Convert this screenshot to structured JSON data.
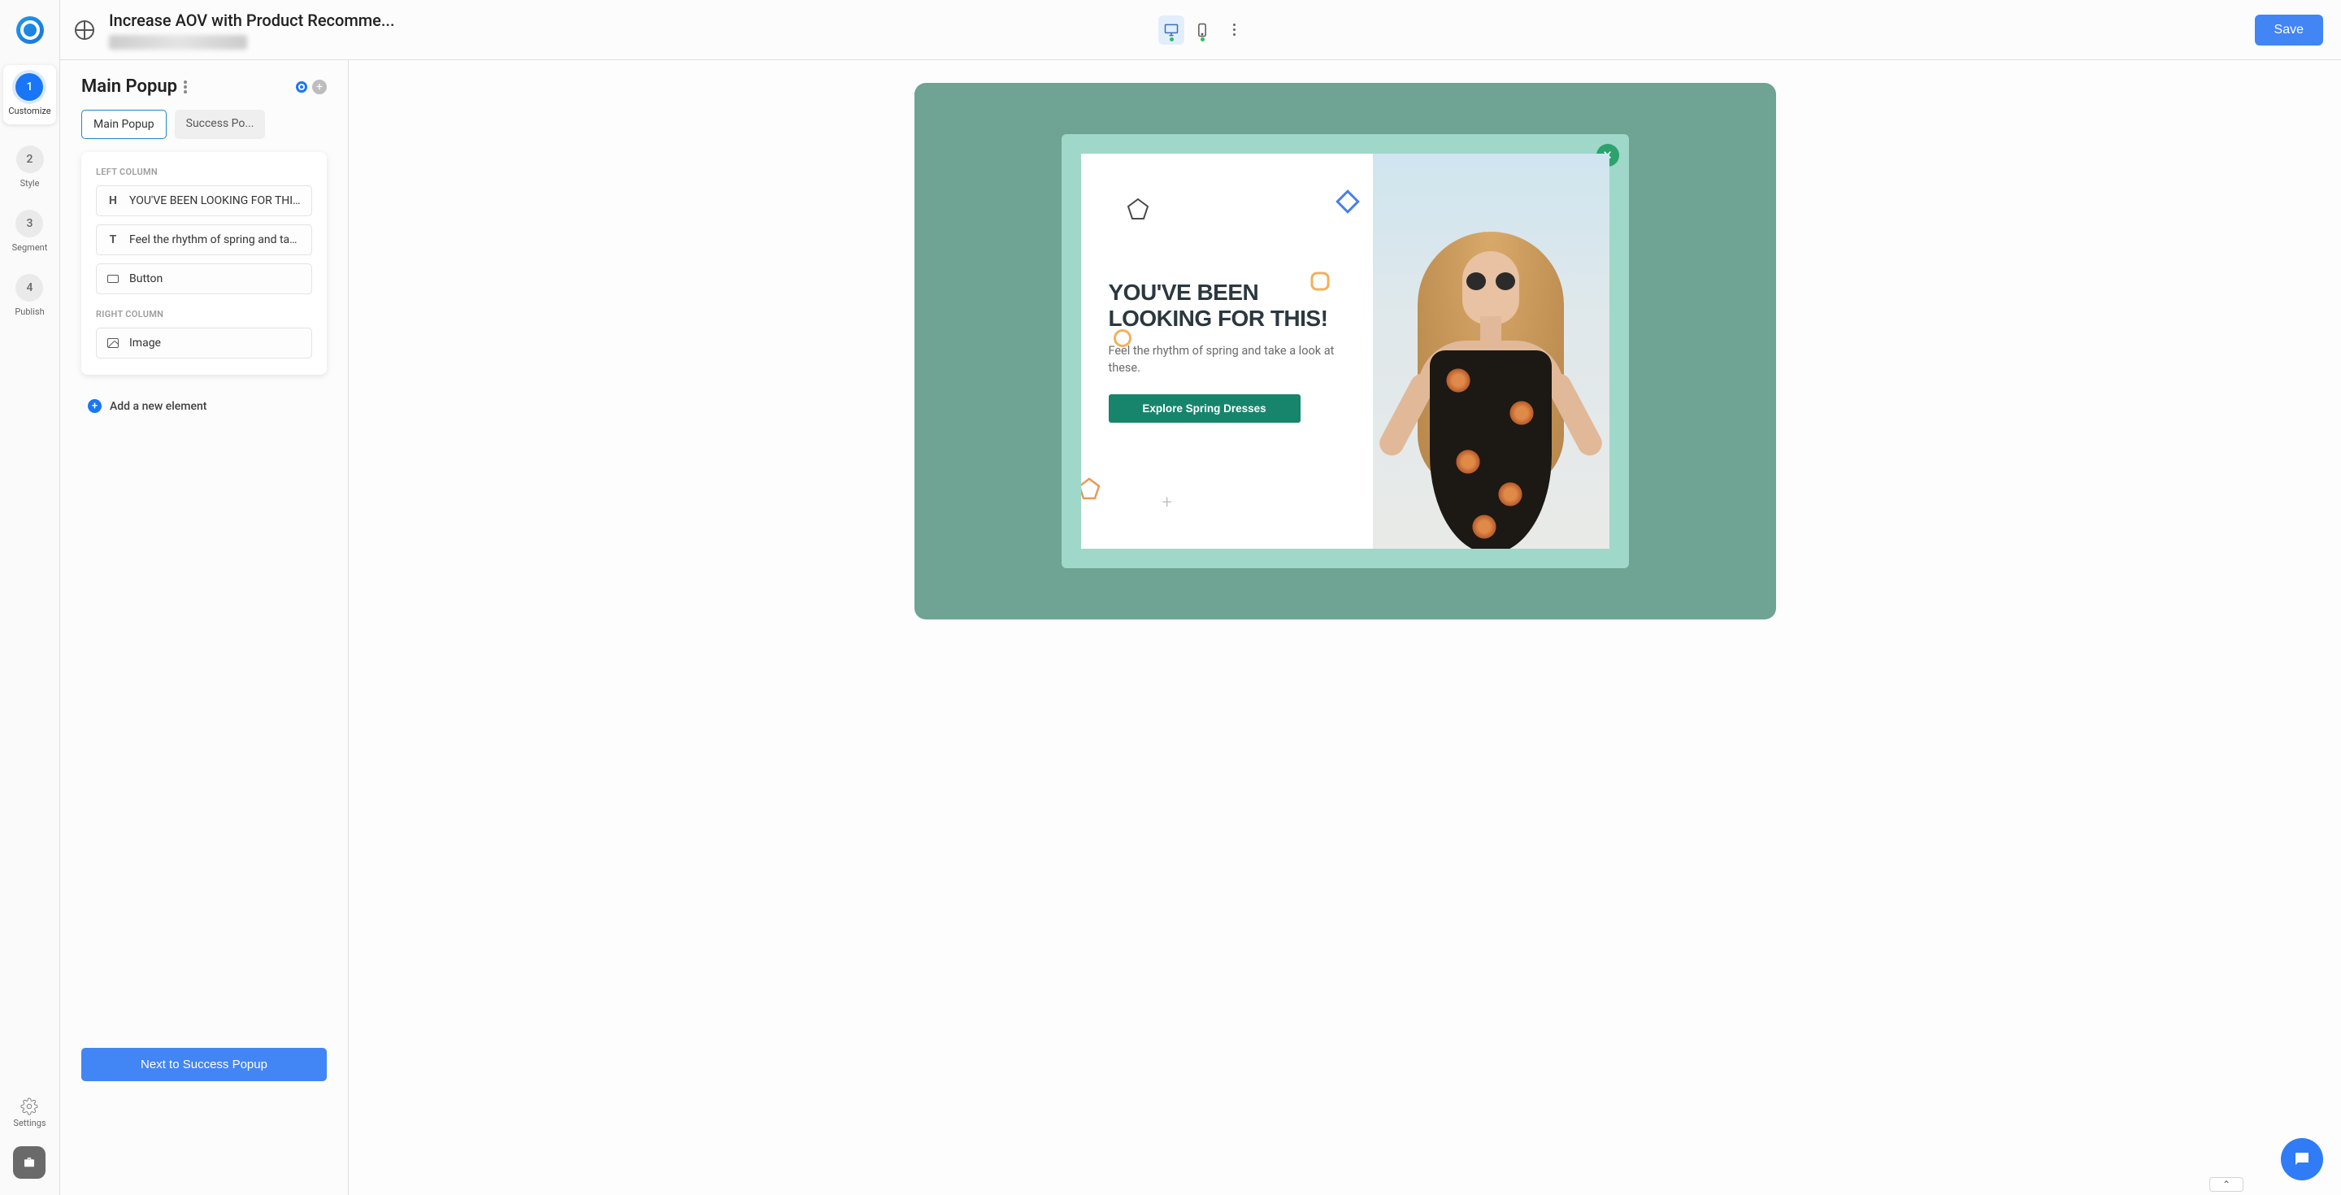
{
  "header": {
    "title": "Increase AOV with Product Recomme...",
    "save_label": "Save"
  },
  "nav": {
    "steps": [
      {
        "num": "1",
        "label": "Customize"
      },
      {
        "num": "2",
        "label": "Style"
      },
      {
        "num": "3",
        "label": "Segment"
      },
      {
        "num": "4",
        "label": "Publish"
      }
    ],
    "settings_label": "Settings"
  },
  "panel": {
    "heading": "Main Popup",
    "tabs": [
      "Main Popup",
      "Success Po..."
    ],
    "left_col_label": "LEFT COLUMN",
    "right_col_label": "RIGHT COLUMN",
    "elements_left": [
      {
        "icon": "H",
        "label": "YOU'VE BEEN LOOKING FOR THIS!"
      },
      {
        "icon": "T",
        "label": "Feel the rhythm of spring and take ..."
      },
      {
        "icon": "button",
        "label": "Button"
      }
    ],
    "elements_right": [
      {
        "icon": "image",
        "label": "Image"
      }
    ],
    "add_element_label": "Add a new element",
    "next_label": "Next to Success Popup"
  },
  "popup": {
    "title": "YOU'VE BEEN LOOKING FOR THIS!",
    "subtitle": "Feel the rhythm of spring and take a look at these.",
    "button_label": "Explore Spring Dresses"
  },
  "colors": {
    "primary": "#4285f4",
    "accent": "#17856c",
    "canvas": "#6fa394",
    "popup_bg": "#9fd7c8"
  }
}
